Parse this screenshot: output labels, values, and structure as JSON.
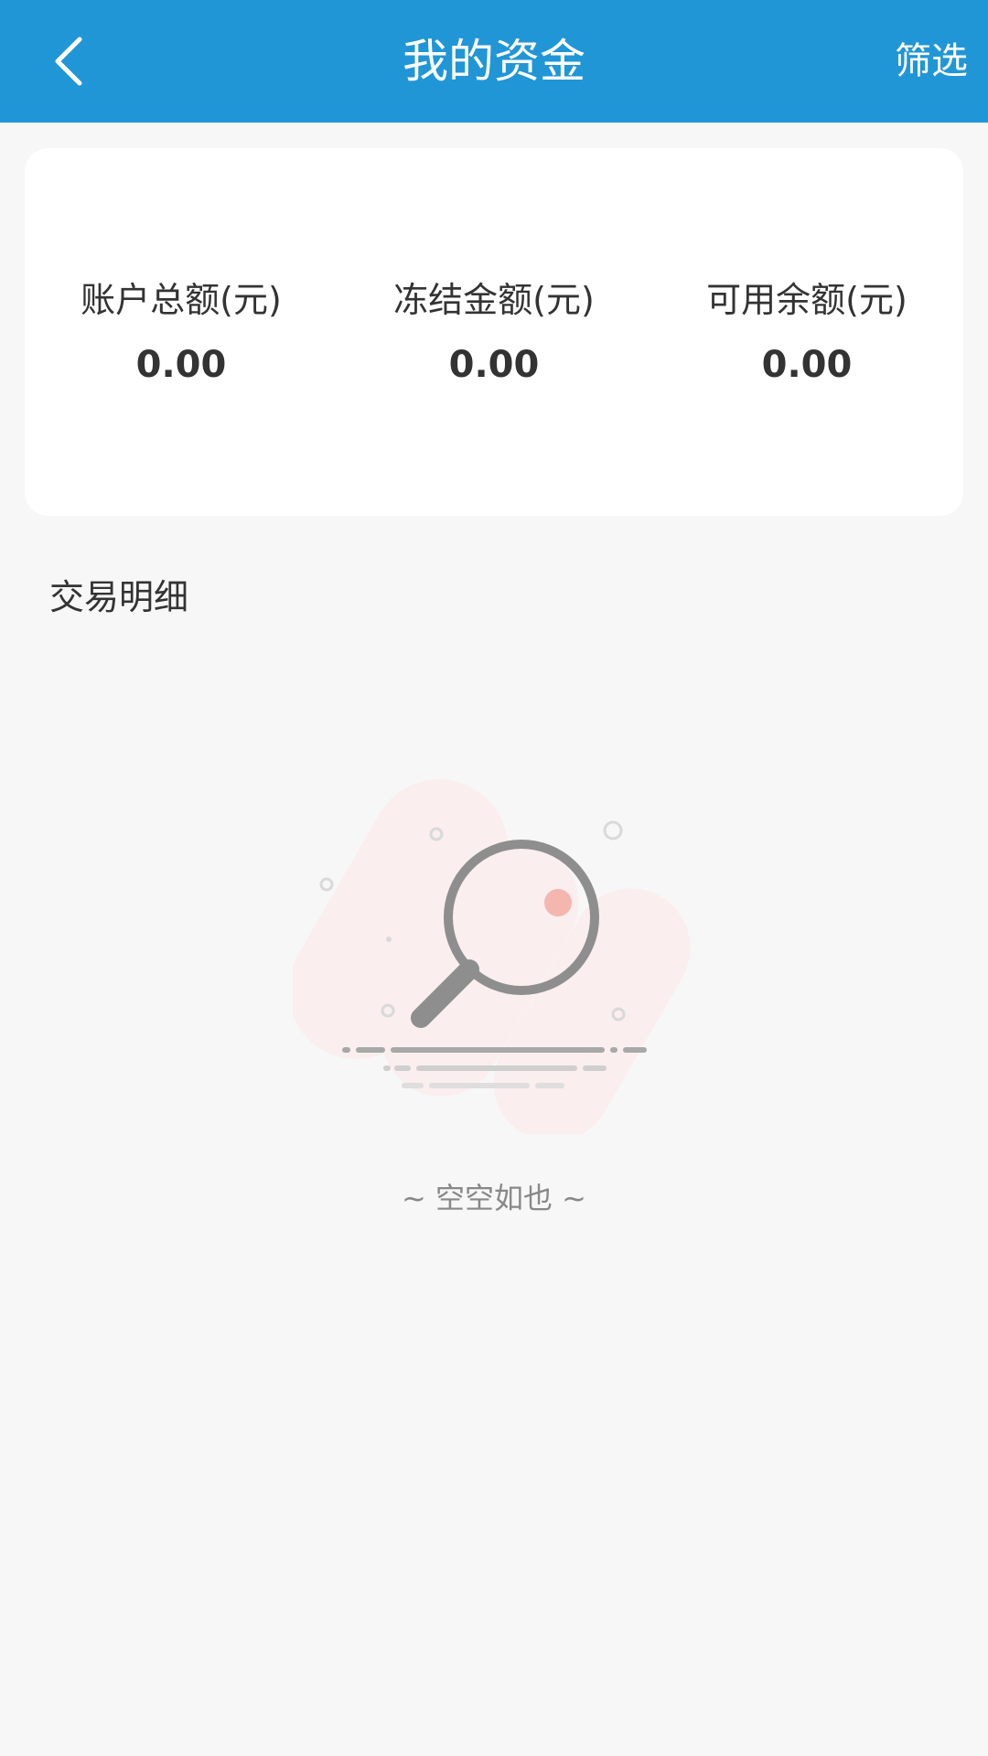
{
  "header": {
    "title": "我的资金",
    "filter_label": "筛选",
    "back_icon": "chevron-left-icon",
    "background_color": "#2196d6"
  },
  "summary": {
    "items": [
      {
        "label": "账户总额(元)",
        "value": "0.00"
      },
      {
        "label": "冻结金额(元)",
        "value": "0.00"
      },
      {
        "label": "可用余额(元)",
        "value": "0.00"
      }
    ]
  },
  "transactions": {
    "title": "交易明细",
    "empty_text": "~ 空空如也 ~",
    "empty_icon": "empty-search-icon"
  }
}
